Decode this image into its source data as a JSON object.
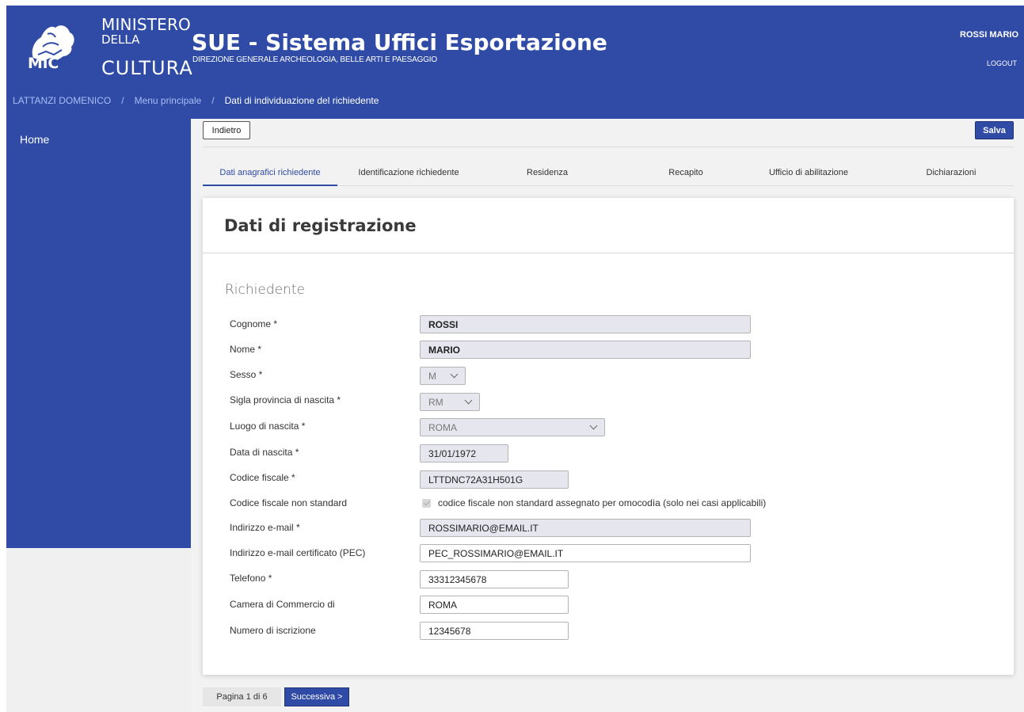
{
  "header": {
    "logo": {
      "line1": "MINISTERO",
      "line2": "DELLA",
      "line3": "CULTURA",
      "abbr": "MiC"
    },
    "app_title": "SUE - Sistema Uffici Esportazione",
    "app_subtitle": "DIREZIONE GENERALE ARCHEOLOGIA, BELLE ARTI E PAESAGGIO",
    "user_name": "ROSSI MARIO",
    "logout_label": "LOGOUT"
  },
  "breadcrumb": {
    "items": [
      "LATTANZI DOMENICO",
      "Menu principale",
      "Dati di individuazione del richiedente"
    ],
    "separator": "/"
  },
  "sidebar": {
    "items": [
      {
        "label": "Home"
      }
    ]
  },
  "toolbar": {
    "back_label": "Indietro",
    "save_label": "Salva"
  },
  "tabs": [
    {
      "label": "Dati anagrafici richiedente",
      "active": true
    },
    {
      "label": "Identificazione richiedente",
      "active": false
    },
    {
      "label": "Residenza",
      "active": false
    },
    {
      "label": "Recapito",
      "active": false
    },
    {
      "label": "Ufficio di abilitazione",
      "active": false
    },
    {
      "label": "Dichiarazioni",
      "active": false
    }
  ],
  "form": {
    "title": "Dati di registrazione",
    "section": "Richiedente",
    "fields": {
      "cognome": {
        "label": "Cognome *",
        "value": "ROSSI"
      },
      "nome": {
        "label": "Nome *",
        "value": "MARIO"
      },
      "sesso": {
        "label": "Sesso *",
        "value": "M"
      },
      "provincia": {
        "label": "Sigla provincia di nascita *",
        "value": "RM"
      },
      "luogo": {
        "label": "Luogo di nascita *",
        "value": "ROMA"
      },
      "data_nascita": {
        "label": "Data di nascita *",
        "value": "31/01/1972"
      },
      "codice_fiscale": {
        "label": "Codice fiscale *",
        "value": "LTTDNC72A31H501G"
      },
      "cf_non_standard": {
        "label": "Codice fiscale non standard",
        "checkbox_label": "codice fiscale non standard assegnato per omocodìa (solo nei casi applicabili)",
        "checked": true
      },
      "email": {
        "label": "Indirizzo e-mail *",
        "value": "ROSSIMARIO@EMAIL.IT"
      },
      "pec": {
        "label": "Indirizzo e-mail certificato (PEC)",
        "value": "PEC_ROSSIMARIO@EMAIL.IT"
      },
      "telefono": {
        "label": "Telefono *",
        "value": "33312345678"
      },
      "camera": {
        "label": "Camera di Commercio di",
        "value": "ROMA"
      },
      "iscrizione": {
        "label": "Numero di iscrizione",
        "value": "12345678"
      }
    }
  },
  "pager": {
    "info": "Pagina 1 di 6",
    "next_label": "Successiva >"
  },
  "colors": {
    "primary": "#2f4ba6",
    "breadcrumb_link": "#a9bdf5",
    "disabled_field": "#e6e6ef",
    "background": "#f2f2f2"
  }
}
